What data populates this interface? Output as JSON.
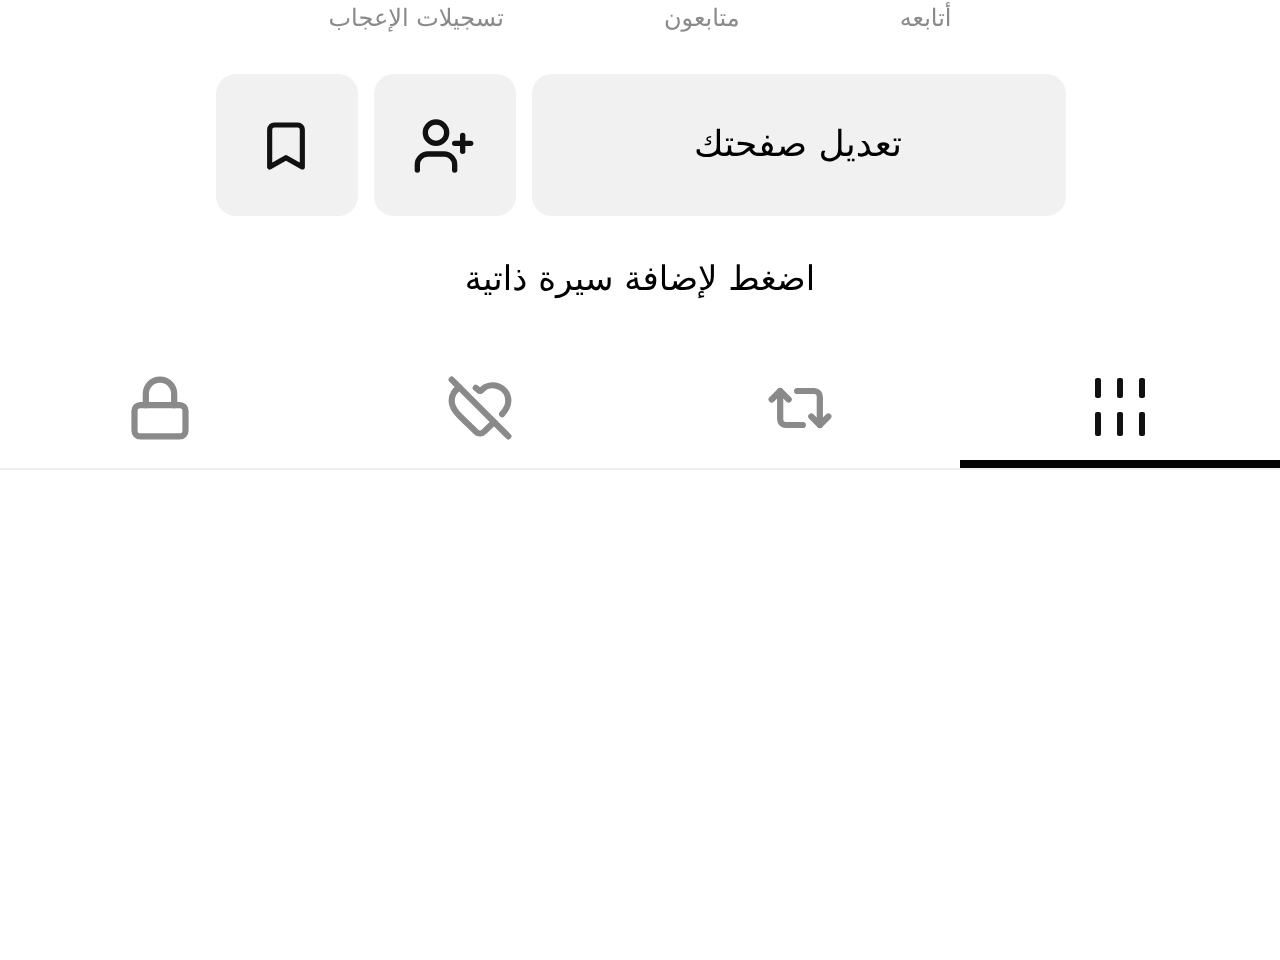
{
  "stats": [
    {
      "label": "أتابعه"
    },
    {
      "label": "متابعون"
    },
    {
      "label": "تسجيلات الإعجاب"
    }
  ],
  "actions": [
    {
      "kind": "edit",
      "label": "تعديل صفحتك"
    },
    {
      "kind": "add-friend"
    },
    {
      "kind": "bookmark"
    }
  ],
  "bio_prompt": "اضغط لإضافة سيرة ذاتية",
  "tabs": [
    {
      "kind": "videos",
      "selected": true
    },
    {
      "kind": "reposts",
      "selected": false
    },
    {
      "kind": "liked",
      "selected": false
    },
    {
      "kind": "private",
      "selected": false
    }
  ]
}
